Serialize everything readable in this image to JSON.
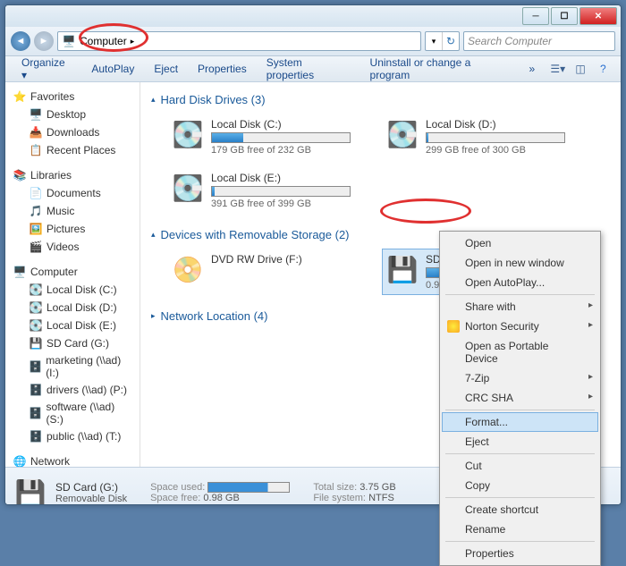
{
  "breadcrumb": {
    "root": "Computer"
  },
  "search": {
    "placeholder": "Search Computer"
  },
  "toolbar": [
    "Organize ▾",
    "AutoPlay",
    "Eject",
    "Properties",
    "System properties",
    "Uninstall or change a program",
    "»"
  ],
  "sidebar": {
    "favorites": {
      "label": "Favorites",
      "items": [
        "Desktop",
        "Downloads",
        "Recent Places"
      ]
    },
    "libraries": {
      "label": "Libraries",
      "items": [
        "Documents",
        "Music",
        "Pictures",
        "Videos"
      ]
    },
    "computer": {
      "label": "Computer",
      "items": [
        "Local Disk (C:)",
        "Local Disk (D:)",
        "Local Disk (E:)",
        "SD Card (G:)",
        "marketing (\\\\ad) (I:)",
        "drivers (\\\\ad) (P:)",
        "software (\\\\ad) (S:)",
        "public (\\\\ad) (T:)"
      ]
    },
    "network": {
      "label": "Network"
    }
  },
  "sections": {
    "hdd": {
      "title": "Hard Disk Drives (3)",
      "drives": [
        {
          "name": "Local Disk (C:)",
          "space": "179 GB free of 232 GB",
          "pct": 23
        },
        {
          "name": "Local Disk (D:)",
          "space": "299 GB free of 300 GB",
          "pct": 1
        },
        {
          "name": "Local Disk (E:)",
          "space": "391 GB free of 399 GB",
          "pct": 2
        }
      ]
    },
    "removable": {
      "title": "Devices with Removable Storage (2)",
      "drives": [
        {
          "name": "DVD RW Drive (F:)",
          "space": ""
        },
        {
          "name": "SD Card (G:)",
          "space": "0.98 GB free of 3.75 GB",
          "pct": 74
        }
      ]
    },
    "network": {
      "title": "Network Location (4)"
    }
  },
  "status": {
    "name": "SD Card (G:)",
    "type": "Removable Disk",
    "used_label": "Space used:",
    "free_label": "Space free:",
    "free_val": "0.98 GB",
    "total_label": "Total size:",
    "total_val": "3.75 GB",
    "fs_label": "File system:",
    "fs_val": "NTFS"
  },
  "context_menu": [
    {
      "label": "Open"
    },
    {
      "label": "Open in new window"
    },
    {
      "label": "Open AutoPlay..."
    },
    {
      "sep": true
    },
    {
      "label": "Share with",
      "sub": true
    },
    {
      "label": "Norton Security",
      "sub": true,
      "shield": true
    },
    {
      "label": "Open as Portable Device"
    },
    {
      "label": "7-Zip",
      "sub": true
    },
    {
      "label": "CRC SHA",
      "sub": true
    },
    {
      "sep": true
    },
    {
      "label": "Format...",
      "hl": true
    },
    {
      "label": "Eject"
    },
    {
      "sep": true
    },
    {
      "label": "Cut"
    },
    {
      "label": "Copy"
    },
    {
      "sep": true
    },
    {
      "label": "Create shortcut"
    },
    {
      "label": "Rename"
    },
    {
      "sep": true
    },
    {
      "label": "Properties"
    }
  ]
}
